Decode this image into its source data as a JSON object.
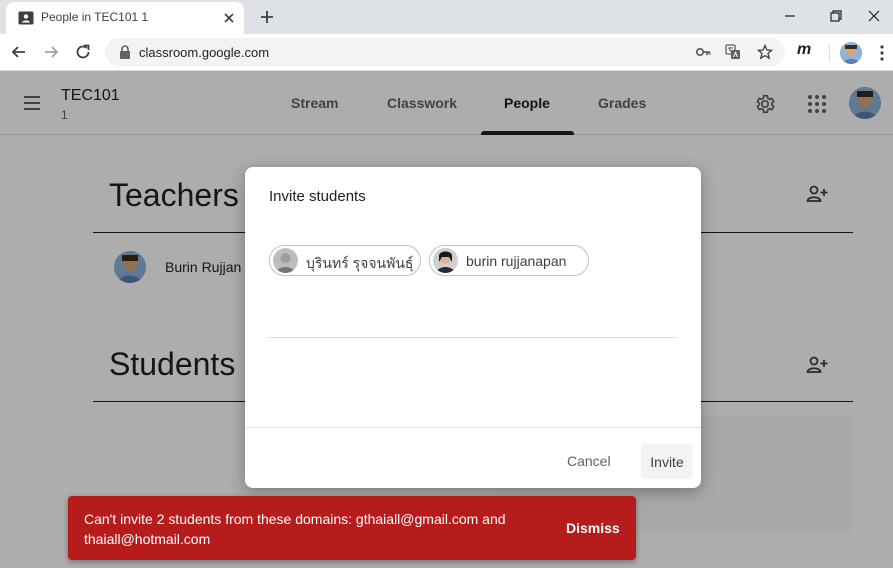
{
  "browser": {
    "tab_title": "People in TEC101 1",
    "url": "classroom.google.com",
    "extension_label": "m"
  },
  "header": {
    "class_name": "TEC101",
    "class_section": "1",
    "tabs": [
      {
        "label": "Stream"
      },
      {
        "label": "Classwork"
      },
      {
        "label": "People"
      },
      {
        "label": "Grades"
      }
    ]
  },
  "main": {
    "teachers_title": "Teachers",
    "students_title": "Students",
    "teacher_name": "Burin Rujjan"
  },
  "dialog": {
    "title": "Invite students",
    "chips": [
      {
        "label": "บุรินทร์ รุจจนพันธุ์"
      },
      {
        "label": "burin rujjanapan"
      }
    ],
    "cancel_label": "Cancel",
    "invite_label": "Invite"
  },
  "snackbar": {
    "message": "Can't invite 2 students from these domains: gthaiall@gmail.com and thaiall@hotmail.com",
    "dismiss_label": "Dismiss"
  },
  "colors": {
    "snackbar_bg": "#b71c1c",
    "scrim": "rgba(0,0,0,0.32)"
  }
}
